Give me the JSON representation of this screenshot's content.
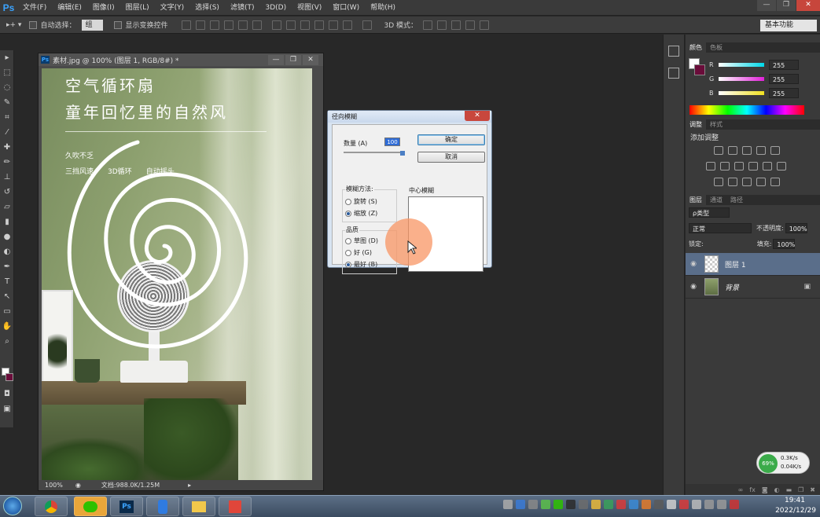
{
  "app": {
    "logo": "Ps"
  },
  "menu": [
    "文件(F)",
    "编辑(E)",
    "图像(I)",
    "图层(L)",
    "文字(Y)",
    "选择(S)",
    "滤镜(T)",
    "3D(D)",
    "视图(V)",
    "窗口(W)",
    "帮助(H)"
  ],
  "window_controls": {
    "minimize": "—",
    "restore": "❐",
    "close": "✕"
  },
  "options_bar": {
    "auto_select_label": "自动选择：",
    "auto_select_value": "组",
    "transform_label": "显示变换控件",
    "mode_3d_label": "3D 模式："
  },
  "workspace": {
    "value": "基本功能"
  },
  "document": {
    "title": "素材.jpg @ 100% (图层 1, RGB/8#) *",
    "zoom": "100%",
    "doc_size": "文档:988.0K/1.25M",
    "headline_1": "空气循环扇",
    "headline_2": "童年回忆里的自然风",
    "feature_lead": "久吹不乏",
    "features": [
      "三挡风速",
      "3D循环",
      "自动摇头"
    ]
  },
  "dialog": {
    "title": "径向模糊",
    "amount_label": "数量 (A)",
    "amount_value": "100",
    "ok": "确定",
    "cancel": "取消",
    "method_label": "模糊方法:",
    "methods": [
      "旋转 (S)",
      "缩放 (Z)"
    ],
    "selected_method": 1,
    "quality_label": "品质",
    "qualities": [
      "草图 (D)",
      "好 (G)",
      "最好 (B)"
    ],
    "selected_quality": 2,
    "center_label": "中心模糊"
  },
  "color_panel": {
    "tabs": [
      "颜色",
      "色板"
    ],
    "channels": [
      {
        "label": "R",
        "value": "255",
        "color": "#00d8e8"
      },
      {
        "label": "G",
        "value": "255",
        "color": "#e020d8"
      },
      {
        "label": "B",
        "value": "255",
        "color": "#f0e020"
      }
    ]
  },
  "adjust_panel": {
    "tabs": [
      "调整",
      "样式"
    ],
    "title": "添加调整"
  },
  "layers_panel": {
    "tabs": [
      "图层",
      "通道",
      "路径"
    ],
    "kind": "ρ类型",
    "blend_mode": "正常",
    "opacity_label": "不透明度:",
    "opacity": "100%",
    "lock_label": "锁定:",
    "fill_label": "填充:",
    "fill": "100%",
    "layers": [
      {
        "name": "图层 1",
        "selected": true
      },
      {
        "name": "背景",
        "selected": false
      }
    ]
  },
  "net_meter": {
    "percent": "69%",
    "up": "0.3K/s",
    "down": "0.04K/s"
  },
  "taskbar": {
    "time": "19:41",
    "date": "2022/12/29",
    "ps_app": "Ps"
  }
}
